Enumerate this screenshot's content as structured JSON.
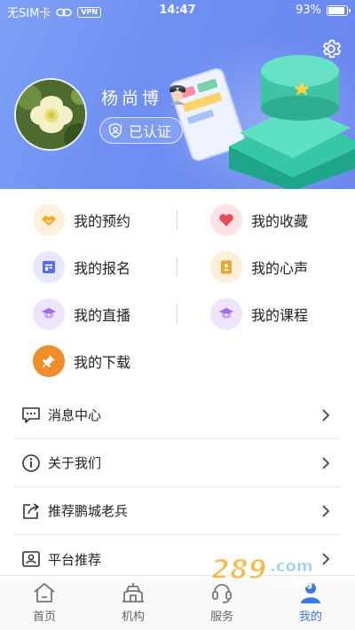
{
  "status_bar": {
    "carrier": "无SIM卡",
    "vpn": "VPN",
    "time": "14:47",
    "battery": "93%",
    "battery_level": 0.93
  },
  "profile": {
    "name": "杨尚博",
    "verified_label": "已认证"
  },
  "features": [
    {
      "label": "我的预约",
      "icon": "handshake-icon",
      "color": "#f5a623",
      "bg": "#fdf1dc"
    },
    {
      "label": "我的收藏",
      "icon": "heart-icon",
      "color": "#e84b5a",
      "bg": "#fde3e6"
    },
    {
      "label": "我的报名",
      "icon": "form-icon",
      "color": "#5b6ef0",
      "bg": "#e6e8fd"
    },
    {
      "label": "我的心声",
      "icon": "notebook-icon",
      "color": "#f0a430",
      "bg": "#fdefd8"
    },
    {
      "label": "我的直播",
      "icon": "graduation-icon",
      "color": "#a06cf0",
      "bg": "#efe4fd"
    },
    {
      "label": "我的课程",
      "icon": "graduation-icon",
      "color": "#a06cf0",
      "bg": "#efe4fd"
    },
    {
      "label": "我的下载",
      "icon": "pin-icon",
      "color": "#ffffff",
      "bg": "#f08c2a"
    }
  ],
  "menu": [
    {
      "label": "消息中心",
      "icon": "message-icon"
    },
    {
      "label": "关于我们",
      "icon": "info-icon"
    },
    {
      "label": "推荐鹏城老兵",
      "icon": "share-icon"
    },
    {
      "label": "平台推荐",
      "icon": "id-card-icon"
    }
  ],
  "tabs": [
    {
      "label": "首页",
      "icon": "home-icon",
      "active": false
    },
    {
      "label": "机构",
      "icon": "building-icon",
      "active": false
    },
    {
      "label": "服务",
      "icon": "service-icon",
      "active": false
    },
    {
      "label": "我的",
      "icon": "user-icon",
      "active": true
    }
  ],
  "colors": {
    "header_blue": "#6d8ef2",
    "tab_active": "#3b78e7"
  }
}
